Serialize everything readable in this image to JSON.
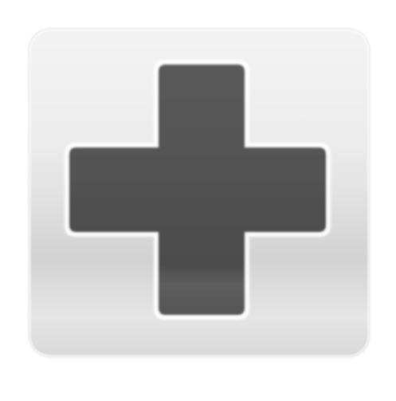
{
  "button": {
    "icon": "plus-icon",
    "label": ""
  },
  "colors": {
    "background": "#ffffff",
    "button_face": "#e6e6e6",
    "plus_fill": "#4e4e4e",
    "plus_highlight": "#ffffff"
  }
}
